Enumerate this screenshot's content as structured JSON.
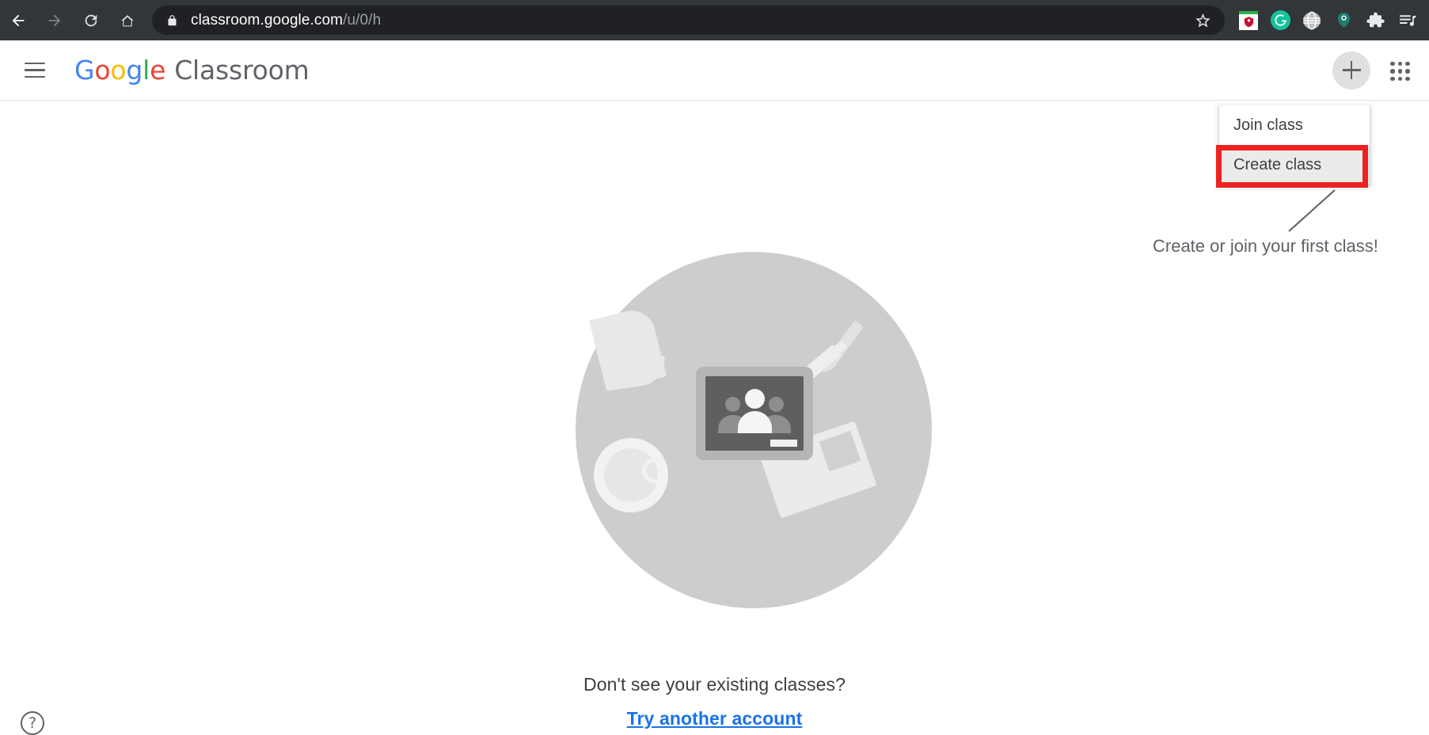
{
  "browser": {
    "nav": {
      "back_label": "Back",
      "forward_label": "Forward",
      "reload_label": "Reload",
      "home_label": "Home"
    },
    "omnibox": {
      "url_domain": "classroom.google.com",
      "url_path": "/u/0/h",
      "full_url": "classroom.google.com/u/0/h",
      "secure": true,
      "lock_icon": "lock-icon",
      "star_icon": "bookmark-star-icon"
    },
    "extensions": [
      {
        "name": "mcafee-webadvisor-extension",
        "label": "McAfee WebAdvisor",
        "color": "#c8102e"
      },
      {
        "name": "grammarly-extension",
        "label": "Grammarly",
        "color": "#15c39a"
      },
      {
        "name": "globe-extension",
        "label": "Translate / Globe",
        "color": "#bdbdbd"
      },
      {
        "name": "teal-bird-extension",
        "label": "Extension",
        "color": "#1f7a73"
      },
      {
        "name": "extensions-puzzle-icon",
        "label": "Extensions",
        "color": "#ffffff"
      },
      {
        "name": "media-playlist-icon",
        "label": "Media list",
        "color": "#ffffff"
      }
    ],
    "chrome_bg": "#323639",
    "omnibox_bg": "#202124"
  },
  "header": {
    "menu_icon": "hamburger-menu-icon",
    "brand": {
      "google_letters": [
        "G",
        "o",
        "o",
        "g",
        "l",
        "e"
      ],
      "product": "Classroom"
    },
    "add_button_label": "+",
    "apps_grid_label": "Google apps"
  },
  "create_menu": {
    "items": [
      {
        "label": "Join class",
        "hovered": false
      },
      {
        "label": "Create class",
        "hovered": true
      }
    ],
    "highlight_color": "#ee2222"
  },
  "annotation": {
    "text": "Create or join your first class!",
    "color": "#5f6368"
  },
  "main": {
    "illustration": {
      "name": "empty-classroom-illustration",
      "circle_color": "#cdcdcd",
      "logo_board_color": "#5f5f5f",
      "logo_frame_color": "#b5b5b5"
    },
    "existing_classes_question": "Don't see your existing classes?",
    "try_another_account_link": "Try another account",
    "link_color": "#1a73e8"
  },
  "footer": {
    "help_icon": "help-circle-icon",
    "help_glyph": "?"
  }
}
